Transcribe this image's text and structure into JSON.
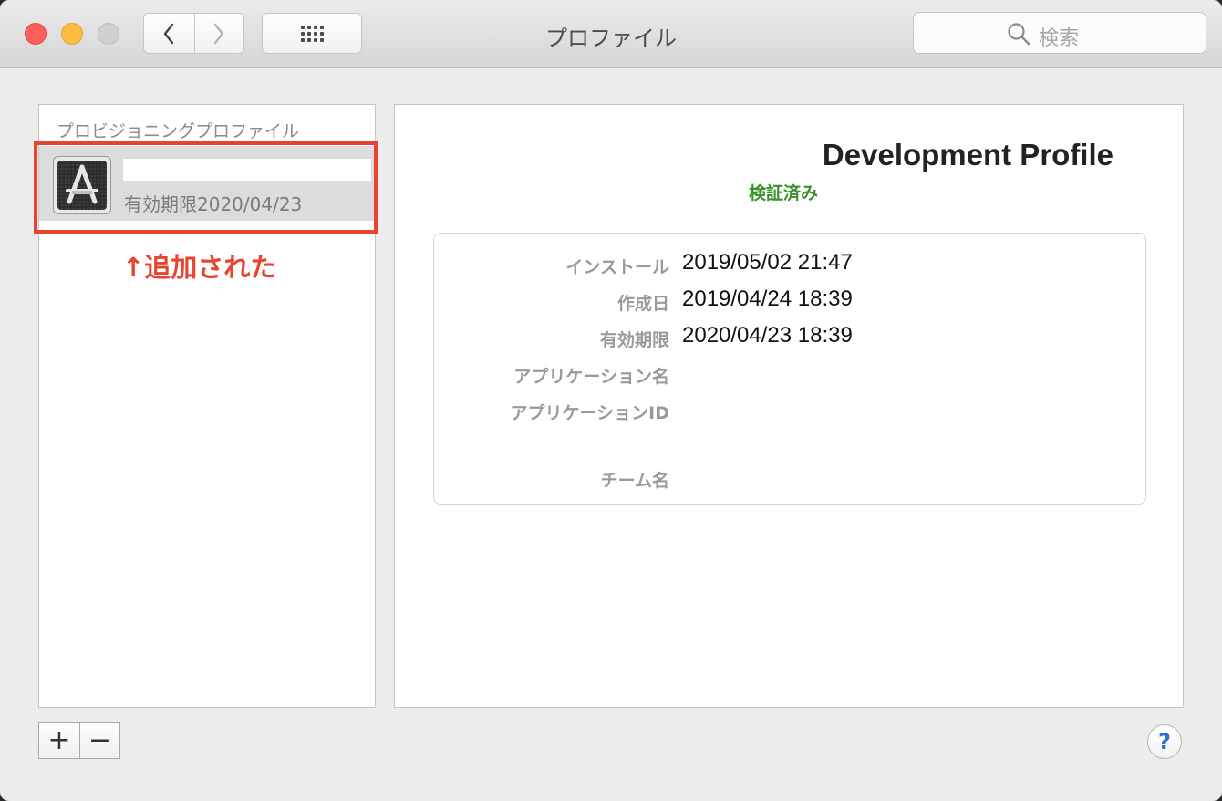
{
  "window": {
    "title": "プロファイル",
    "search_placeholder": "検索"
  },
  "list": {
    "header": "プロビジョニングプロファイル",
    "items": [
      {
        "name": "",
        "expiry": "有効期限2020/04/23",
        "selected": true
      }
    ],
    "annotation": "↑追加された"
  },
  "detail": {
    "title": "Development Profile",
    "status": "検証済み",
    "rows": [
      {
        "label": "インストール",
        "value": "2019/05/02 21:47"
      },
      {
        "label": "作成日",
        "value": "2019/04/24 18:39"
      },
      {
        "label": "有効期限",
        "value": "2020/04/23 18:39"
      },
      {
        "label": "アプリケーション名",
        "value": ""
      },
      {
        "label": "アプリケーションID",
        "value": ""
      },
      {
        "label": "チーム名",
        "value": ""
      }
    ]
  },
  "controls": {
    "add_label": "+",
    "remove_label": "−",
    "help_label": "?"
  },
  "colors": {
    "annotation": "#e8432f",
    "verified": "#3a8f2c",
    "help": "#2a6fd6"
  }
}
